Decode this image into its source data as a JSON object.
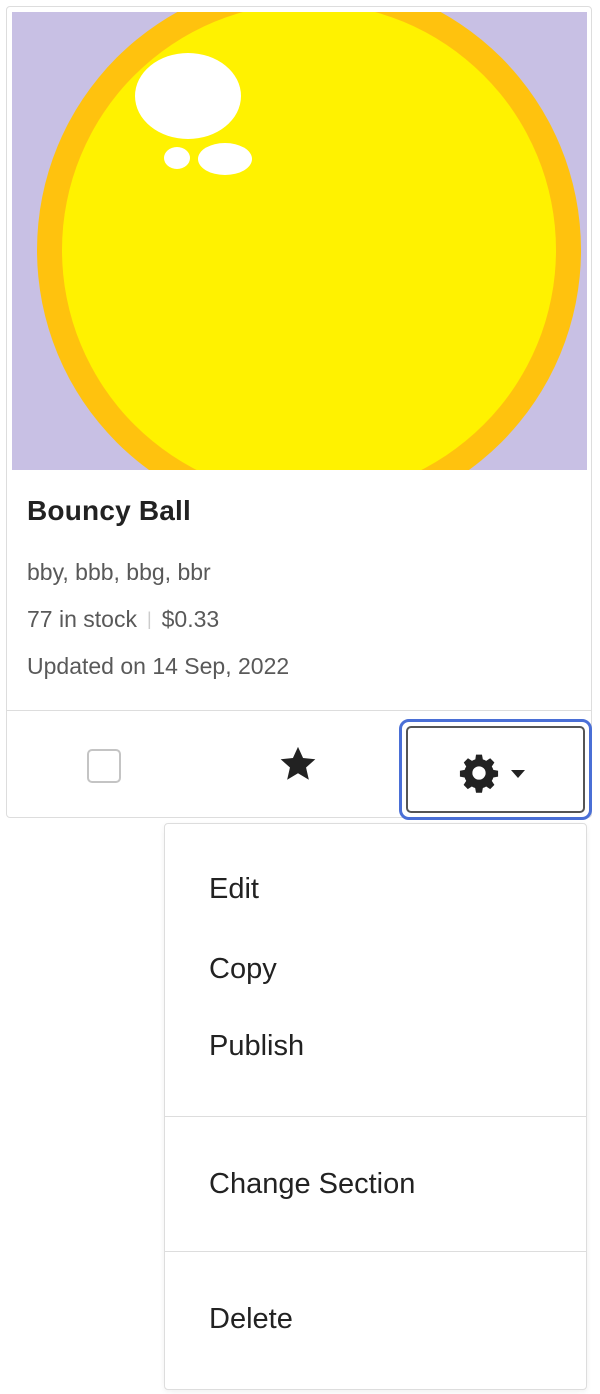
{
  "listing": {
    "title": "Bouncy Ball",
    "skus": "bby, bbb, bbg, bbr",
    "stock": "77 in stock",
    "price": "$0.33",
    "updated": "Updated on 14 Sep, 2022"
  },
  "colors": {
    "accent_focus": "#4a6fd6",
    "thumb_bg": "#c8c0e4",
    "ball_fill": "#fff200",
    "ball_rim": "#ffc20e"
  },
  "icons": {
    "favorite": "star-icon",
    "settings": "gear-icon",
    "dropdown": "caret-down-icon"
  },
  "menu": {
    "items": [
      {
        "label": "Edit"
      },
      {
        "label": "Copy"
      },
      {
        "label": "Publish"
      },
      {
        "label": "Change Section"
      },
      {
        "label": "Delete"
      }
    ]
  }
}
